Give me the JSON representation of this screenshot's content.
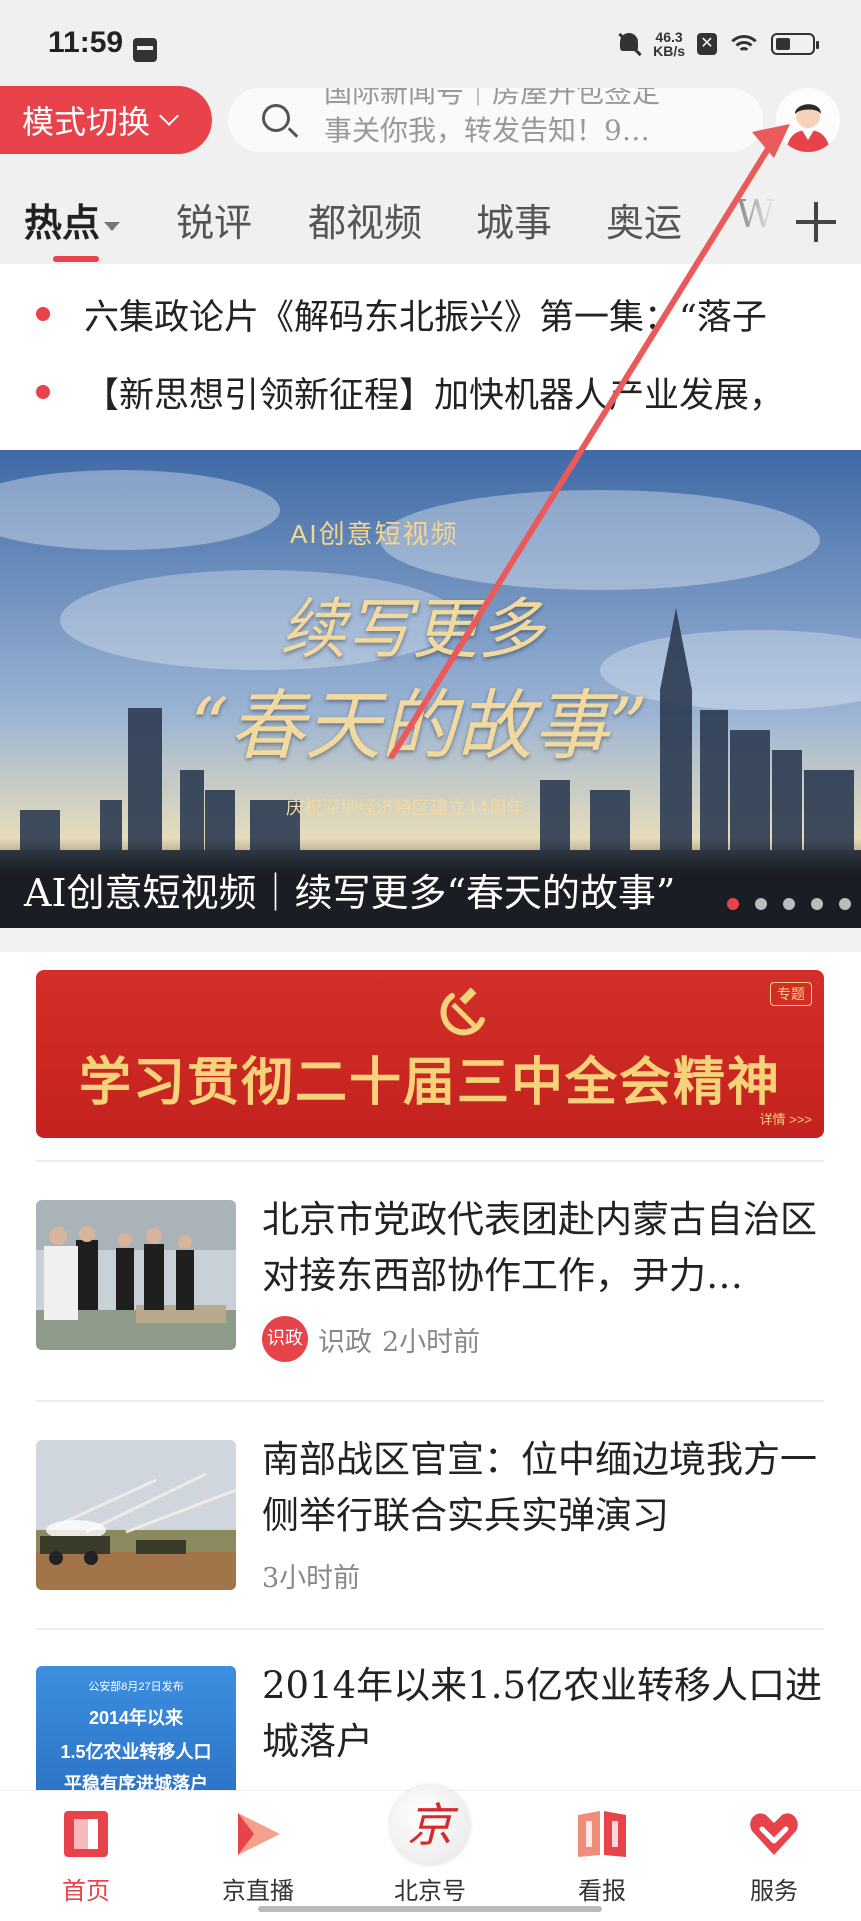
{
  "status_bar": {
    "time": "11:59",
    "net_speed_value": "46.3",
    "net_speed_unit": "KB/s"
  },
  "header": {
    "mode_button_label": "模式切换",
    "search_lines": [
      "国际新闻号｜房屋开包签定",
      "事关你我，转发告知！9…"
    ]
  },
  "tabs": [
    {
      "label": "热点",
      "active": true
    },
    {
      "label": "锐评"
    },
    {
      "label": "都视频"
    },
    {
      "label": "城事"
    },
    {
      "label": "奥运"
    },
    {
      "label": "W"
    }
  ],
  "headlines": [
    "六集政论片《解码东北振兴》第一集：“落子",
    "【新思想引领新征程】加快机器人产业发展，"
  ],
  "banner": {
    "tag": "AI创意短视频",
    "art_line1": "续写更多",
    "art_line2": "“春天的故事”",
    "art_line3": "庆祝深圳经济特区建立44周年",
    "caption": "AI创意短视频｜续写更多“春天的故事”",
    "page_count": 5,
    "active_page": 1
  },
  "special": {
    "title": "学习贯彻二十届三中全会精神",
    "tag": "专题",
    "more": "详情 >>>"
  },
  "news": [
    {
      "title": "北京市党政代表团赴内蒙古自治区对接东西部协作工作，尹力…",
      "source_badge": "识政",
      "source": "识政",
      "time": "2小时前"
    },
    {
      "title": "南部战区官宣：位中缅边境我方一侧举行联合实兵实弹演习",
      "time": "3小时前"
    },
    {
      "title": "2014年以来1.5亿农业转移人口进城落户",
      "thumb_lines": [
        "公安部8月27日发布",
        "2014年以来",
        "1.5亿农业转移人口",
        "平稳有序进城落户"
      ]
    }
  ],
  "bottom_nav": [
    {
      "label": "首页",
      "icon": "home-icon",
      "active": true
    },
    {
      "label": "京直播",
      "icon": "live-play-icon"
    },
    {
      "label": "北京号",
      "icon": "jing-seal-icon",
      "seal_char": "京"
    },
    {
      "label": "看报",
      "icon": "newspaper-icon"
    },
    {
      "label": "服务",
      "icon": "heart-service-icon"
    }
  ],
  "colors": {
    "accent": "#e8434a",
    "special_bg": "#c4221e",
    "special_text": "#f6d27a"
  }
}
